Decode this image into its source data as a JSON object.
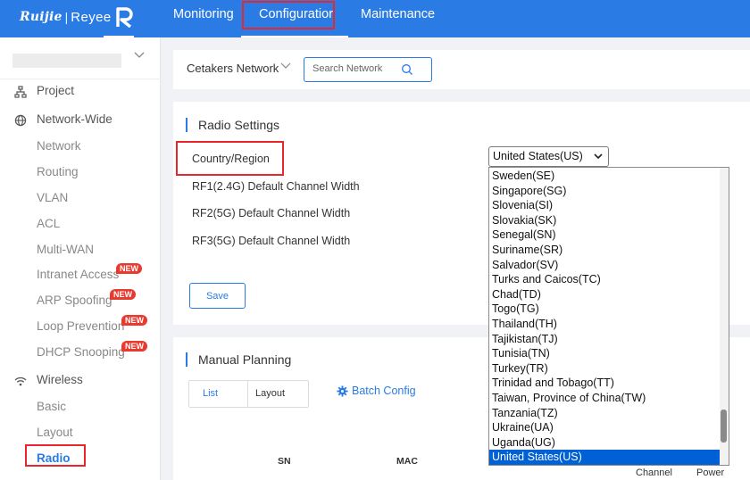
{
  "brand": {
    "name": "Ruijie",
    "separator": "|",
    "product": "Reyee"
  },
  "topnav": {
    "monitoring": "Monitoring",
    "configuration": "Configuratior",
    "maintenance": "Maintenance"
  },
  "sidebar": {
    "project": "Project",
    "network_wide": "Network-Wide",
    "items": [
      "Network",
      "Routing",
      "VLAN",
      "ACL",
      "Multi-WAN",
      "Intranet Access",
      "ARP Spoofing",
      "Loop Prevention",
      "DHCP Snooping"
    ],
    "badge": "NEW",
    "wireless": "Wireless",
    "wireless_items": [
      "Basic",
      "Layout",
      "Radio"
    ]
  },
  "network_bar": {
    "network_name": "Cetakers Network",
    "search_placeholder": "Search Network"
  },
  "radio_settings": {
    "title": "Radio Settings",
    "country_label": "Country/Region",
    "rf1_label": "RF1(2.4G) Default Channel Width",
    "rf2_label": "RF2(5G) Default Channel Width",
    "rf3_label": "RF3(5G) Default Channel Width",
    "save_label": "Save",
    "country_value": "United States(US)"
  },
  "country_options": [
    "Sweden(SE)",
    "Singapore(SG)",
    "Slovenia(SI)",
    "Slovakia(SK)",
    "Senegal(SN)",
    "Suriname(SR)",
    "Salvador(SV)",
    "Turks and Caicos(TC)",
    "Chad(TD)",
    "Togo(TG)",
    "Thailand(TH)",
    "Tajikistan(TJ)",
    "Tunisia(TN)",
    "Turkey(TR)",
    "Trinidad and Tobago(TT)",
    "Taiwan, Province of China(TW)",
    "Tanzania(TZ)",
    "Ukraine(UA)",
    "Uganda(UG)",
    "United States(US)"
  ],
  "selected_country_index": 19,
  "manual_planning": {
    "title": "Manual Planning",
    "tab_list": "List",
    "tab_layout": "Layout",
    "batch_config": "Batch Config",
    "col_sn": "SN",
    "col_mac": "MAC",
    "col_channel": "Channel",
    "col_power": "Power"
  },
  "colors": {
    "primary": "#2a7be4",
    "highlight": "#e8262b",
    "badge": "#e83a2f",
    "selected_option": "#0060d6"
  }
}
